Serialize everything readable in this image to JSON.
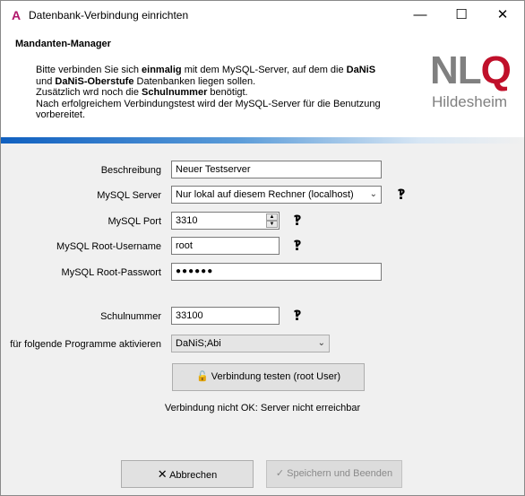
{
  "window": {
    "title": "Datenbank-Verbindung einrichten",
    "app_icon": "app-logo-icon",
    "controls": [
      "minimize-icon",
      "maximize-icon",
      "close-icon"
    ]
  },
  "header": {
    "title": "Mandanten-Manager",
    "text_parts": [
      "Bitte verbinden Sie sich ",
      "einmalig",
      " mit dem MySQL-Server, auf dem die ",
      "DaNiS",
      "und ",
      "DaNiS-Oberstufe",
      " Datenbanken liegen sollen.",
      "Zusätzlich wrd noch die ",
      "Schulnummer",
      " benötigt.",
      "Nach erfolgreichem Verbindungstest wird der MySQL-Server für die Benutzung vorbereitet."
    ],
    "logo_main_1": "NL",
    "logo_main_2": "Q",
    "logo_sub": "Hildesheim"
  },
  "form": {
    "beschreibung_label": "Beschreibung",
    "beschreibung_value": "Neuer Testserver",
    "server_label": "MySQL Server",
    "server_value": "Nur lokal auf diesem Rechner (localhost)",
    "port_label": "MySQL Port",
    "port_value": "3310",
    "username_label": "MySQL Root-Username",
    "username_value": "root",
    "password_label": "MySQL Root-Passwort",
    "password_value": "●●●●●●",
    "schulnummer_label": "Schulnummer",
    "schulnummer_value": "33100",
    "programme_label": "für folgende Programme aktivieren",
    "programme_value": "DaNiS;Abi",
    "test_button": "Verbindung testen (root User)",
    "status": "Verbindung nicht OK: Server nicht erreichbar"
  },
  "footer": {
    "cancel_label": "Abbrechen",
    "save_label": "Speichern und Beenden"
  },
  "colors": {
    "accent_blue": "#1060c0",
    "logo_red": "#c0102a",
    "logo_gray": "#808080"
  }
}
